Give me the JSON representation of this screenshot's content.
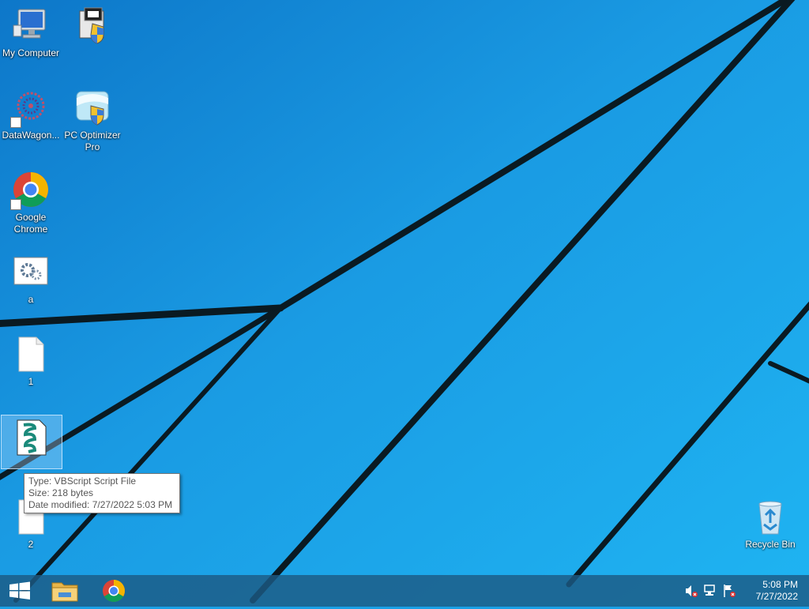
{
  "desktop": {
    "icons": [
      {
        "label": "My Computer",
        "icon": "my-computer-icon"
      },
      {
        "label": "",
        "icon": "installer-shield-icon"
      },
      {
        "label": "DataWagon...",
        "icon": "datawagon-icon"
      },
      {
        "label": "PC Optimizer Pro",
        "icon": "pc-optimizer-pro-icon"
      },
      {
        "label": "Google Chrome",
        "icon": "chrome-icon"
      },
      {
        "label": "a",
        "icon": "settings-file-icon"
      },
      {
        "label": "1",
        "icon": "blank-file-icon"
      },
      {
        "label": "",
        "icon": "vbscript-file-icon"
      },
      {
        "label": "2",
        "icon": "blank-file-icon"
      },
      {
        "label": "Recycle Bin",
        "icon": "recycle-bin-icon"
      }
    ]
  },
  "tooltip": {
    "type": "Type: VBScript Script File",
    "size": "Size: 218 bytes",
    "modified": "Date modified: 7/27/2022 5:03 PM"
  },
  "taskbar": {
    "start": "start-button",
    "pinned": [
      "file-explorer-icon",
      "chrome-icon"
    ],
    "tray": [
      "volume-muted-icon",
      "network-icon",
      "action-center-flag-icon"
    ],
    "clock": {
      "time": "5:08 PM",
      "date": "7/27/2022"
    }
  },
  "colors": {
    "wallpaper": "#1aa0e6",
    "taskbar": "#1c5a84"
  }
}
